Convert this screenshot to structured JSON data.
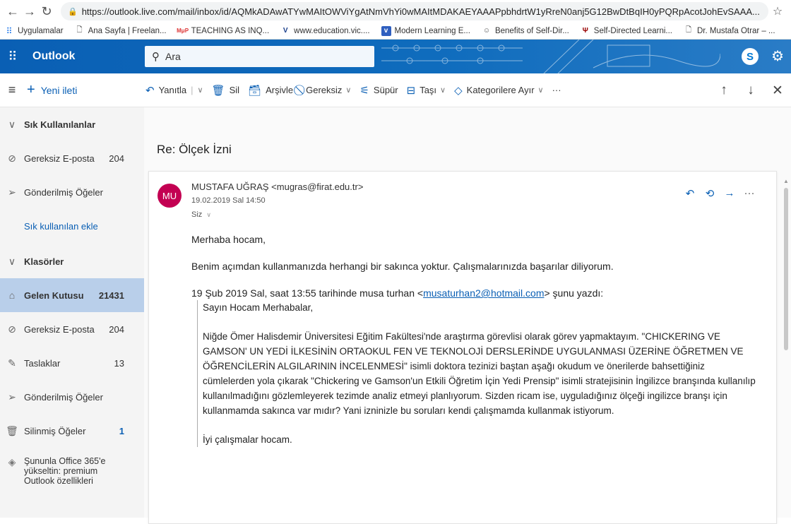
{
  "browser": {
    "url": "https://outlook.live.com/mail/inbox/id/AQMkADAwATYwMAItOWViYgAtNmVhYi0wMAItMDAKAEYAAAPpbhdrtW1yRreN0anj5G12BwDtBqIH0yPQRpAcotJohEvSAAA...",
    "bookmarks": [
      {
        "icon": "apps-grid-icon",
        "label": "Uygulamalar"
      },
      {
        "icon": "page-icon",
        "label": "Ana Sayfa | Freelan..."
      },
      {
        "icon": "mup-icon",
        "label": "TEACHING AS INQ..."
      },
      {
        "icon": "vic-icon",
        "label": "www.education.vic...."
      },
      {
        "icon": "v-icon",
        "label": "Modern Learning E..."
      },
      {
        "icon": "people-icon",
        "label": "Benefits of Self-Dir..."
      },
      {
        "icon": "iu-icon",
        "label": "Self-Directed Learni..."
      },
      {
        "icon": "page-icon",
        "label": "Dr. Mustafa Otrar – ..."
      }
    ]
  },
  "header": {
    "brand": "Outlook",
    "search_placeholder": "Ara",
    "skype_label": "S"
  },
  "toolbar": {
    "new_message": "Yeni ileti",
    "reply": "Yanıtla",
    "delete": "Sil",
    "archive": "Arşivle",
    "junk": "Gereksiz",
    "sweep": "Süpür",
    "move": "Taşı",
    "categorize": "Kategorilere Ayır",
    "more": "···"
  },
  "sidebar": {
    "favorites_title": "Sık Kullanılanlar",
    "favorites": [
      {
        "label": "Gereksiz E-posta",
        "count": "204"
      },
      {
        "label": "Gönderilmiş Öğeler",
        "count": ""
      }
    ],
    "add_favorite": "Sık kullanılan ekle",
    "folders_title": "Klasörler",
    "folders": [
      {
        "label": "Gelen Kutusu",
        "count": "21431"
      },
      {
        "label": "Gereksiz E-posta",
        "count": "204"
      },
      {
        "label": "Taslaklar",
        "count": "13"
      },
      {
        "label": "Gönderilmiş Öğeler",
        "count": ""
      },
      {
        "label": "Silinmiş Öğeler",
        "count": "1"
      }
    ],
    "upgrade": "Şununla Office 365'e yükseltin: premium Outlook özellikleri"
  },
  "message": {
    "subject": "Re: Ölçek İzni",
    "avatar_initials": "MU",
    "sender": "MUSTAFA UĞRAŞ <mugras@firat.edu.tr>",
    "date": "19.02.2019 Sal 14:50",
    "to": "Siz",
    "greeting": "Merhaba hocam,",
    "reply_text": "Benim açımdan kullanmanızda herhangi bir sakınca yoktur. Çalışmalarınızda başarılar diliyorum.",
    "quote_header_pre": "19 Şub 2019 Sal, saat 13:55 tarihinde musa turhan <",
    "quote_email": "musaturhan2@hotmail.com",
    "quote_header_post": "> şunu yazdı:",
    "quote_greeting": "Sayın Hocam Merhabalar,",
    "quote_body": "Niğde Ömer Halisdemir Üniversitesi Eğitim Fakültesi'nde araştırma görevlisi olarak görev yapmaktayım. \"CHICKERING VE GAMSON' UN YEDİ İLKESİNİN ORTAOKUL FEN VE TEKNOLOJİ DERSLERİNDE UYGULANMASI ÜZERİNE ÖĞRETMEN VE ÖĞRENCİLERİN ALGILARININ İNCELENMESİ\" isimli doktora tezinizi baştan aşağı okudum ve önerilerde bahsettiğiniz cümlelerden yola çıkarak \"Chickering ve Gamson'un Etkili Öğretim İçin Yedi Prensip\" isimli stratejisinin İngilizce branşında kullanılıp kullanılmadığını gözlemleyerek tezimde analiz etmeyi planlıyorum. Sizden ricam ise, uyguladığınız ölçeği ingilizce branşı için kullanmamda sakınca var mıdır? Yani izninizle bu soruları kendi çalışmamda kullanmak istiyorum.",
    "quote_closing": "İyi çalışmalar hocam."
  }
}
